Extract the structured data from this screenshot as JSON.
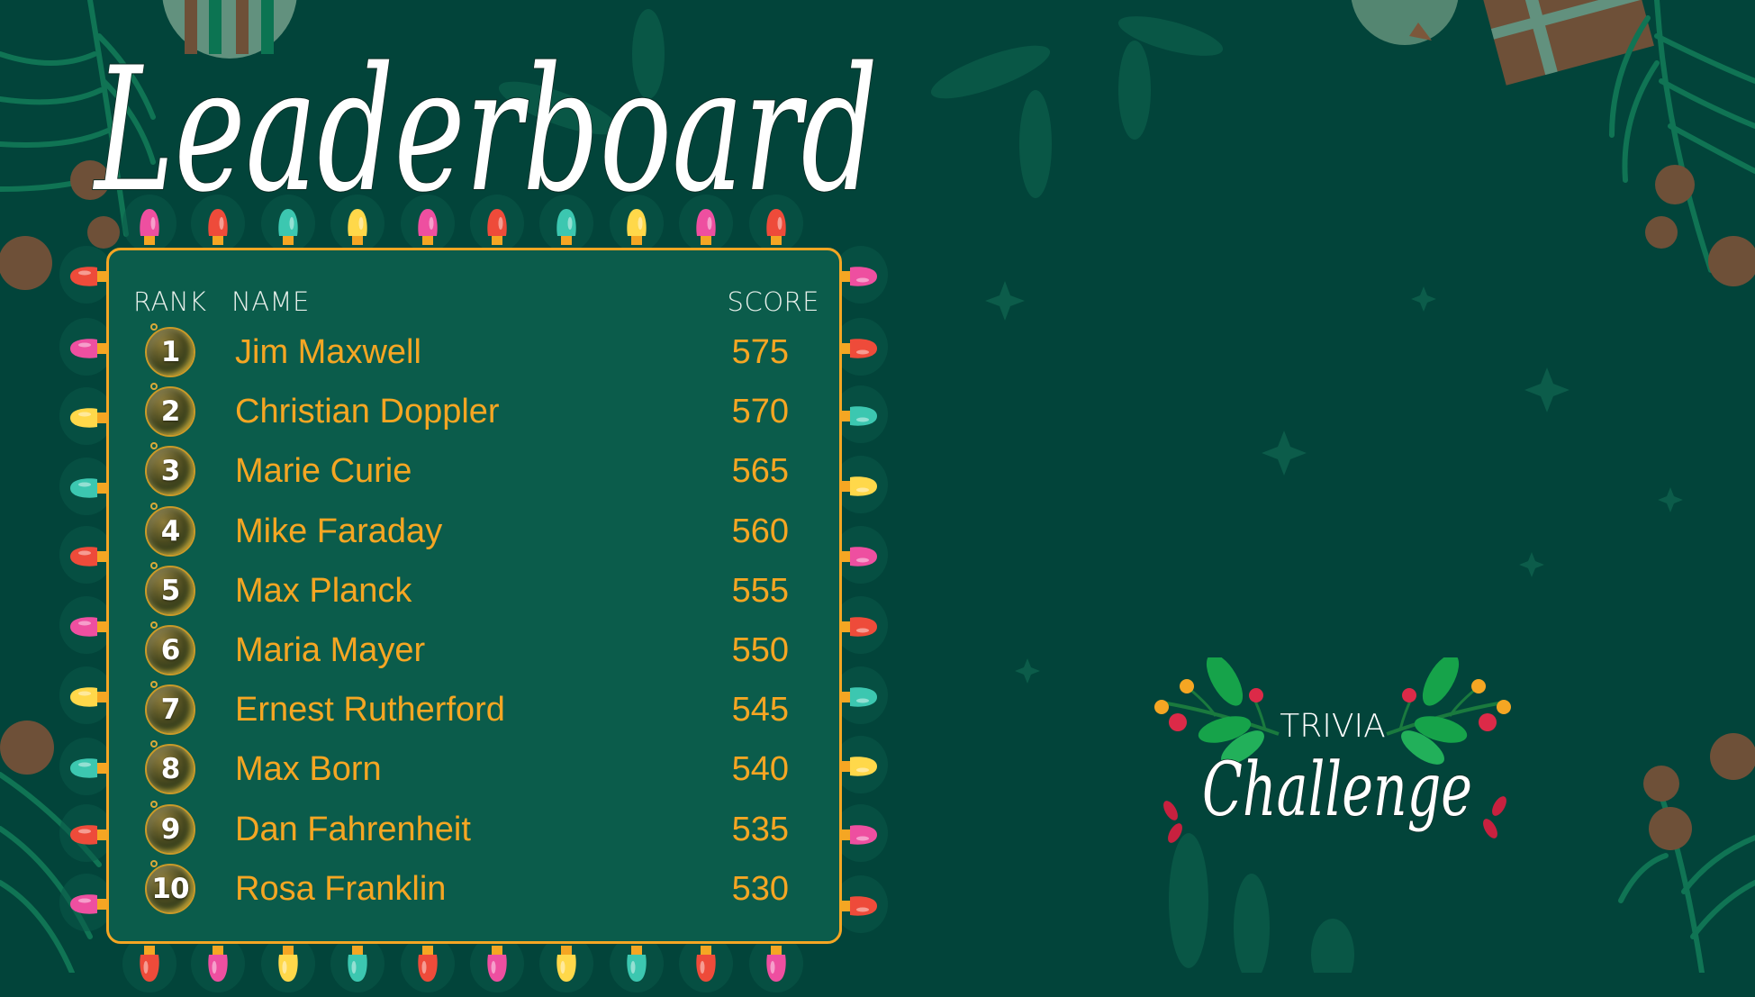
{
  "title": "Leaderboard",
  "table": {
    "headers": {
      "rank": "RANK",
      "name": "NAME",
      "score": "SCORE"
    },
    "rows": [
      {
        "rank": "1",
        "name": "Jim Maxwell",
        "score": "575"
      },
      {
        "rank": "2",
        "name": "Christian Doppler",
        "score": "570"
      },
      {
        "rank": "3",
        "name": "Marie Curie",
        "score": "565"
      },
      {
        "rank": "4",
        "name": "Mike Faraday",
        "score": "560"
      },
      {
        "rank": "5",
        "name": "Max Planck",
        "score": "555"
      },
      {
        "rank": "6",
        "name": "Maria Mayer",
        "score": "550"
      },
      {
        "rank": "7",
        "name": "Ernest Rutherford",
        "score": "545"
      },
      {
        "rank": "8",
        "name": "Max Born",
        "score": "540"
      },
      {
        "rank": "9",
        "name": "Dan Fahrenheit",
        "score": "535"
      },
      {
        "rank": "10",
        "name": "Rosa Franklin",
        "score": "530"
      }
    ]
  },
  "logo": {
    "line1": "TRIVIA",
    "line2": "Challenge"
  },
  "colors": {
    "background": "#02443A",
    "board": "#0B5C4B",
    "accent": "#F5A623",
    "header_text": "#E6EFEA",
    "bulbs": {
      "pink": "#EE4FA0",
      "red": "#EE4B3A",
      "teal": "#3CC7B0",
      "yellow": "#FFD84A"
    }
  },
  "lights": {
    "top": [
      "pink",
      "red",
      "teal",
      "yellow",
      "pink",
      "red",
      "teal",
      "yellow",
      "pink",
      "red"
    ],
    "bottom": [
      "red",
      "pink",
      "yellow",
      "teal",
      "red",
      "pink",
      "yellow",
      "teal",
      "red",
      "pink"
    ],
    "left": [
      "red",
      "pink",
      "yellow",
      "teal",
      "red",
      "pink",
      "yellow",
      "teal",
      "red",
      "pink"
    ],
    "right": [
      "pink",
      "red",
      "teal",
      "yellow",
      "pink",
      "red",
      "teal",
      "yellow",
      "pink",
      "red"
    ]
  },
  "icons": {
    "rank_badge": "ornament-bauble-icon",
    "light": "christmas-light-bulb-icon"
  }
}
